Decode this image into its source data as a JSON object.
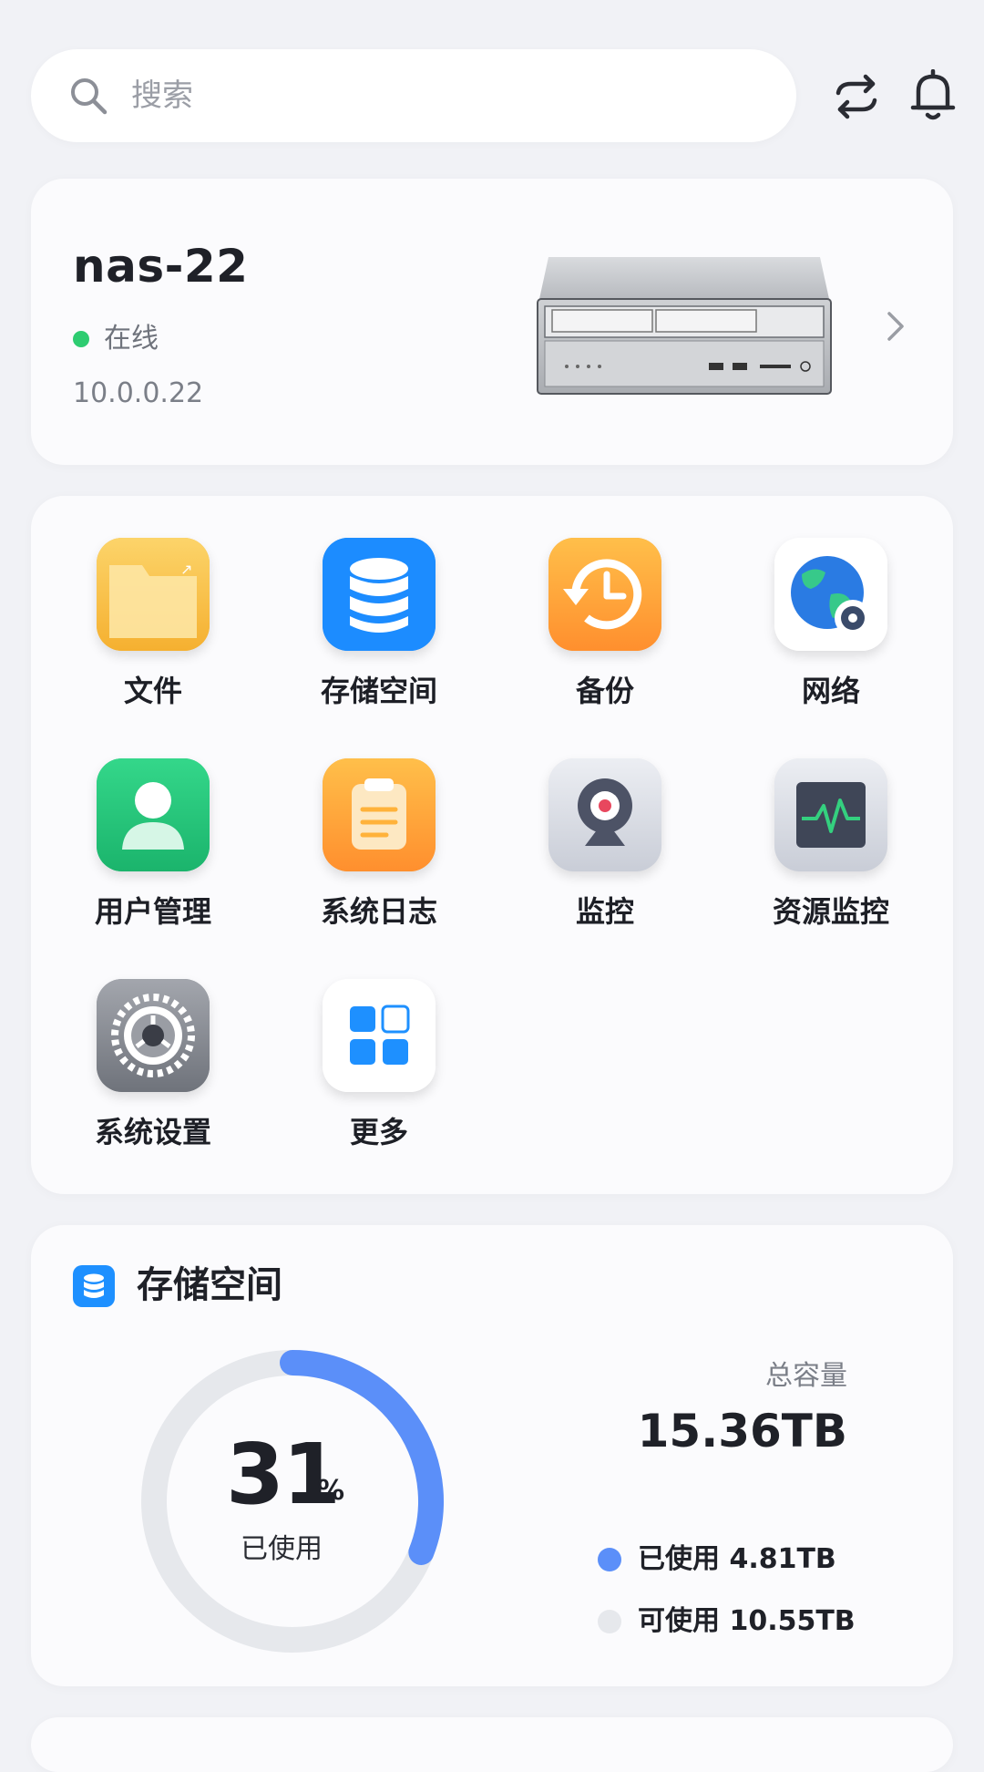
{
  "search": {
    "placeholder": "搜索"
  },
  "device": {
    "name": "nas-22",
    "status": "在线",
    "ip": "10.0.0.22"
  },
  "apps": [
    {
      "label": "文件",
      "icon": "folder-icon"
    },
    {
      "label": "存储空间",
      "icon": "database-icon"
    },
    {
      "label": "备份",
      "icon": "backup-clock-icon"
    },
    {
      "label": "网络",
      "icon": "globe-gear-icon"
    },
    {
      "label": "用户管理",
      "icon": "user-icon"
    },
    {
      "label": "系统日志",
      "icon": "clipboard-icon"
    },
    {
      "label": "监控",
      "icon": "camera-icon"
    },
    {
      "label": "资源监控",
      "icon": "activity-monitor-icon"
    },
    {
      "label": "系统设置",
      "icon": "gear-icon"
    },
    {
      "label": "更多",
      "icon": "grid-icon"
    }
  ],
  "storage": {
    "title": "存储空间",
    "percent": "31",
    "percent_symbol": "%",
    "used_caption": "已使用",
    "total_label": "总容量",
    "total_value": "15.36TB",
    "legend_used": "已使用 4.81TB",
    "legend_free": "可使用 10.55TB",
    "used_fraction": 0.31,
    "colors": {
      "used": "#5b8ff9",
      "free": "#e6e8ec"
    }
  }
}
